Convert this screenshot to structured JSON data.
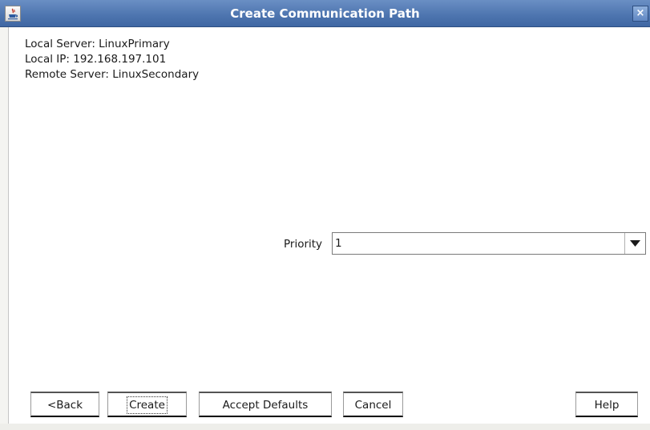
{
  "window": {
    "title": "Create Communication Path",
    "close_symbol": "×",
    "icon": "java-app-icon"
  },
  "info": {
    "local_server": "Local Server: LinuxPrimary",
    "local_ip": "Local IP: 192.168.197.101",
    "remote_server": "Remote Server: LinuxSecondary"
  },
  "priority": {
    "label": "Priority",
    "value": "1"
  },
  "buttons": {
    "back": "<Back",
    "create": "Create",
    "accept_defaults": "Accept Defaults",
    "cancel": "Cancel",
    "help": "Help"
  }
}
